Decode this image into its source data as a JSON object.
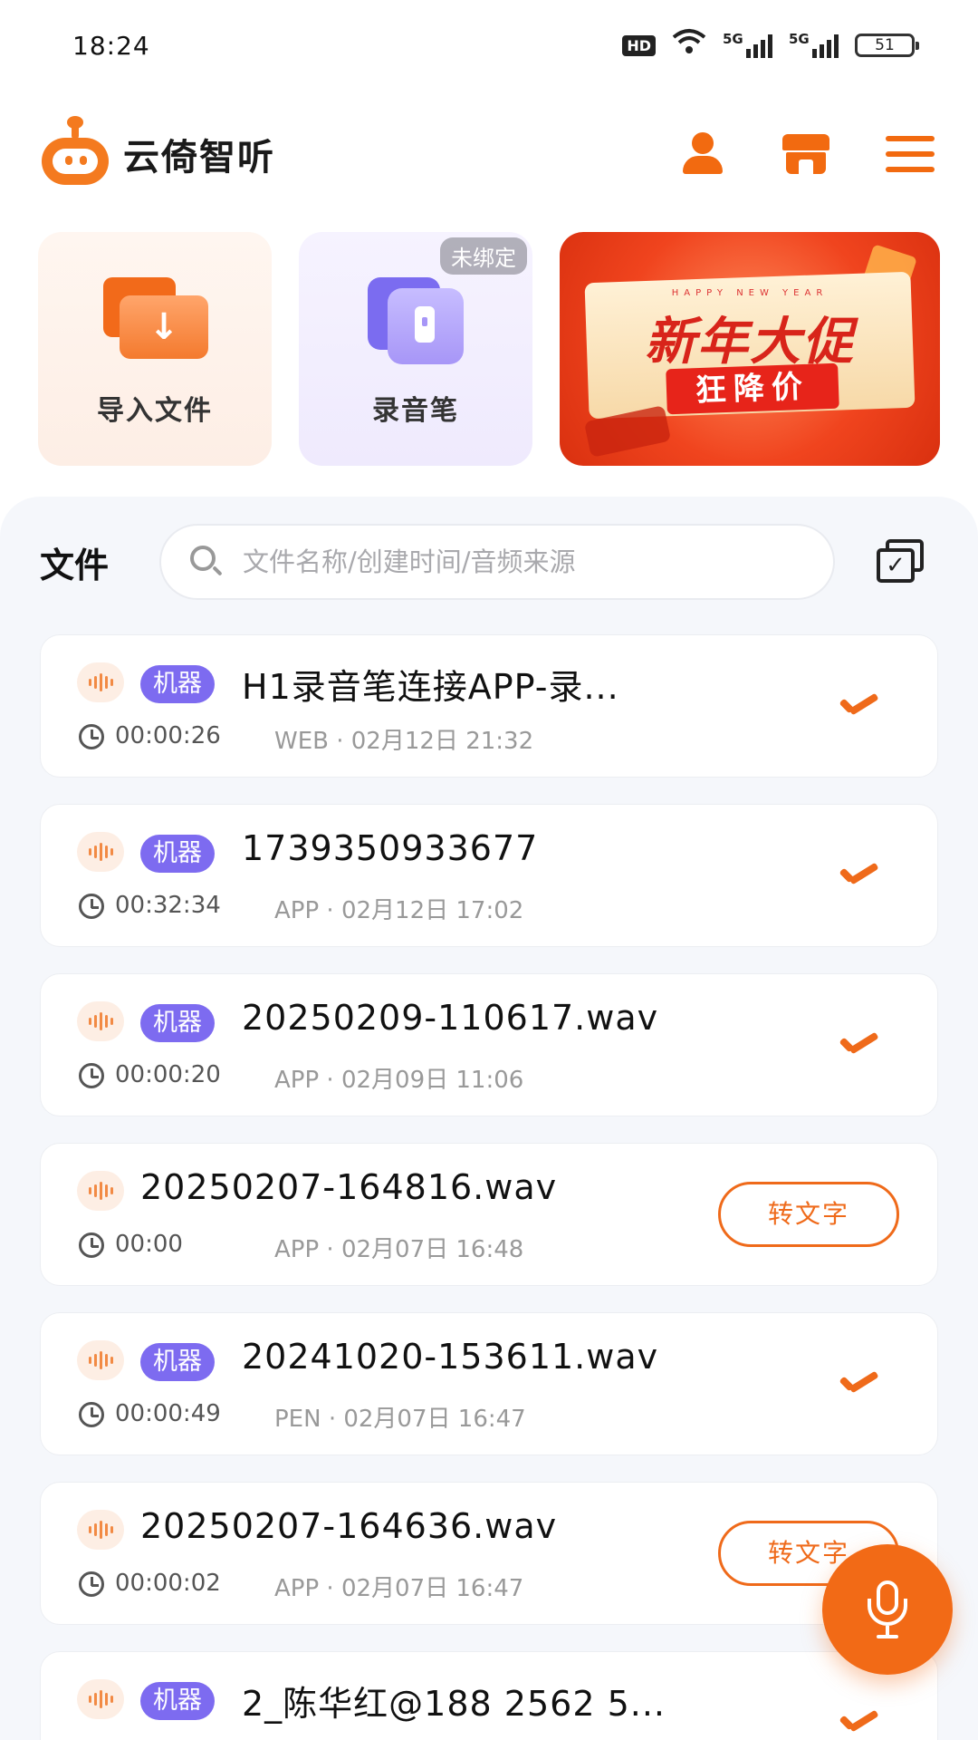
{
  "status_bar": {
    "time": "18:24",
    "hd": "HD",
    "net1": "5G",
    "net2": "5G",
    "battery": "51"
  },
  "header": {
    "app_name": "云倚智听",
    "icons": [
      "user-icon",
      "store-icon",
      "menu-icon"
    ]
  },
  "quick_actions": {
    "import_label": "导入文件",
    "pen_label": "录音笔",
    "pen_badge": "未绑定",
    "promo": {
      "small_text": "HAPPY NEW YEAR",
      "title": "新年大促",
      "subtitle": "狂降价"
    }
  },
  "files": {
    "title": "文件",
    "search_placeholder": "文件名称/创建时间/音频来源",
    "items": [
      {
        "badge": "机器",
        "name": "H1录音笔连接APP-录...",
        "duration": "00:00:26",
        "meta": "WEB · 02月12日 21:32",
        "status": "done"
      },
      {
        "badge": "机器",
        "name": "1739350933677",
        "duration": "00:32:34",
        "meta": "APP · 02月12日 17:02",
        "status": "done"
      },
      {
        "badge": "机器",
        "name": "20250209-110617.wav",
        "duration": "00:00:20",
        "meta": "APP · 02月09日 11:06",
        "status": "done"
      },
      {
        "badge": "",
        "name": "20250207-164816.wav",
        "duration": "00:00",
        "meta": "APP · 02月07日 16:48",
        "status": "pending",
        "action": "转文字"
      },
      {
        "badge": "机器",
        "name": "20241020-153611.wav",
        "duration": "00:00:49",
        "meta": "PEN · 02月07日 16:47",
        "status": "done"
      },
      {
        "badge": "",
        "name": "20250207-164636.wav",
        "duration": "00:00:02",
        "meta": "APP · 02月07日 16:47",
        "status": "pending",
        "action": "转文字"
      },
      {
        "badge": "机器",
        "name": "2_陈华红@188 2562 5...",
        "duration": "",
        "meta": "",
        "status": "done"
      }
    ]
  },
  "colors": {
    "accent": "#f26a16",
    "badge_purple": "#7d6bf0",
    "panel_bg": "#f5f7fb"
  }
}
